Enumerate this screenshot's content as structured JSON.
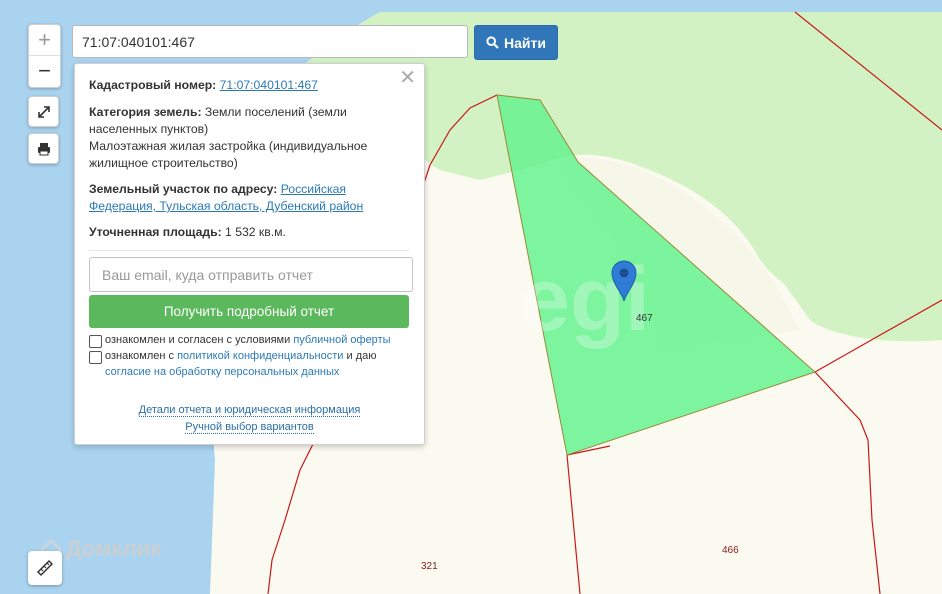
{
  "colors": {
    "water": "#a9d3ef",
    "forest": "#d3f2c4",
    "land": "#fbfaf0",
    "parcel_fill": "#66f28f",
    "parcel_border": "#9a8a3a",
    "boundary": "#c91a1a",
    "accent": "#3176b8",
    "green_button": "#5cb85c",
    "marker": "#2f7bd6"
  },
  "toolbar": {
    "zoom_in": "+",
    "zoom_out": "−",
    "fullscreen_icon": "expand-icon",
    "print_icon": "printer-icon"
  },
  "search": {
    "value": "71:07:040101:467",
    "button_label": "Найти",
    "button_icon": "search-icon"
  },
  "popup": {
    "close": "✕",
    "cadastral_label": "Кадастровый номер:",
    "cadastral_value": "71:07:040101:467",
    "category_label": "Категория земель:",
    "category_value": "Земли поселений (земли населенных пунктов)",
    "use_value": "Малоэтажная жилая застройка (индивидуальное жилищное строительство)",
    "address_label": "Земельный участок по адресу:",
    "address_value": "Российская Федерация, Тульская область, Дубенский район",
    "area_label": "Уточненная площадь:",
    "area_value": "1 532 кв.м.",
    "email_placeholder": "Ваш email, куда отправить отчет",
    "report_button": "Получить подробный отчет",
    "consent1_text": "ознакомлен и согласен с условиями",
    "consent1_link": "публичной оферты",
    "consent2_text": "ознакомлен с",
    "consent2_link": "политикой конфиденциальности",
    "consent2_mid": "и даю",
    "consent2_link2": "согласие на обработку персональных данных",
    "details_link": "Детали отчета и юридическая информация",
    "manual_link": "Ручной выбор вариантов"
  },
  "map": {
    "parcel_label": "467",
    "parcel_466": "466",
    "parcel_321": "321",
    "watermark_text": "Домклик",
    "egrn_watermark": "egi",
    "ruler_icon": "ruler-icon",
    "marker_icon": "map-pin-icon"
  }
}
